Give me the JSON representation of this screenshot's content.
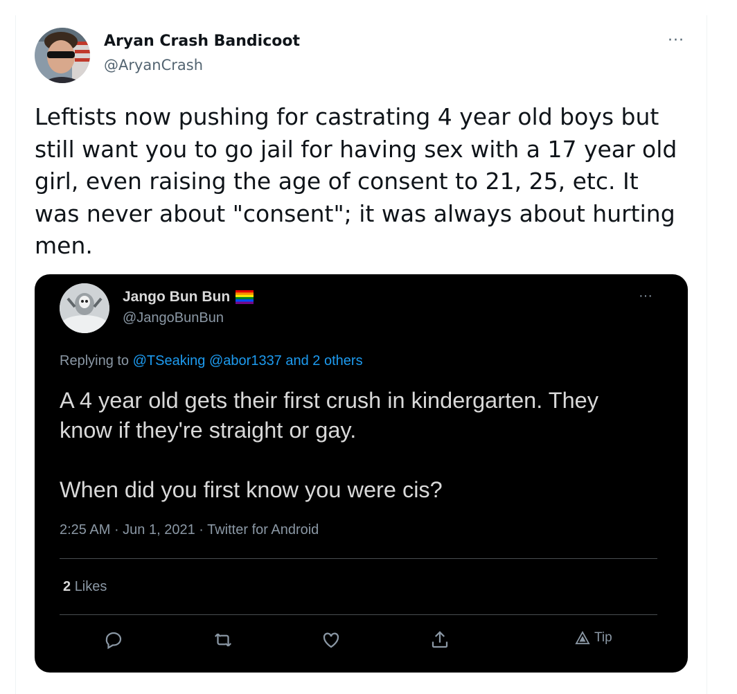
{
  "author": {
    "display_name": "Aryan Crash Bandicoot",
    "handle": "@AryanCrash",
    "more_icon": "more-horizontal-icon",
    "more_label": "···"
  },
  "tweet": {
    "text": "Leftists now pushing for castrating 4 year old boys but\nstill want you to go jail for having sex with a 17 year old\ngirl, even raising the age of consent to 21, 25, etc. It\nwas never about \"consent\"; it was always about hurting\nmen."
  },
  "quoted": {
    "display_name": "Jango Bun Bun",
    "handle": "@JangoBunBun",
    "more_label": "···",
    "replying_prefix": "Replying to",
    "replying_to": [
      "@TSeaking",
      "@abor1337"
    ],
    "replying_others": "and 2 others",
    "text": "A 4 year old gets their first crush in kindergarten. They\nknow if they're straight or gay.\n\nWhen did you first know you were cis?",
    "time": "2:25 AM",
    "date": "Jun 1, 2021",
    "source": "Twitter for Android",
    "likes_count": "2",
    "likes_label": "Likes",
    "tip_label": "Tip",
    "colors": {
      "background": "#000000",
      "text": "#d9d9d9",
      "secondary": "#8b98a5",
      "link": "#1d9bf0"
    }
  }
}
